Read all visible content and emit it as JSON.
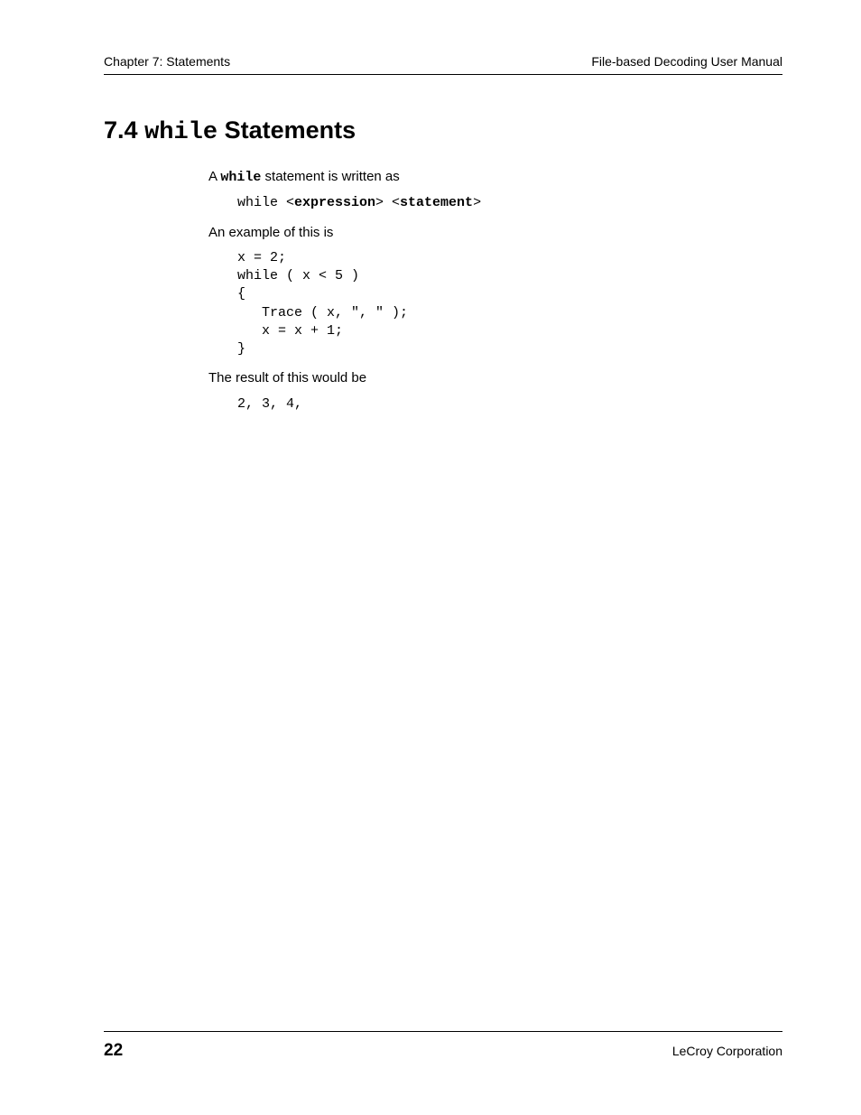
{
  "header": {
    "left": "Chapter 7: Statements",
    "right": "File-based Decoding User Manual"
  },
  "section": {
    "number": "7.4",
    "keyword": "while",
    "heading_suffix": " Statements"
  },
  "body": {
    "p1_prefix": "A ",
    "p1_code": "while",
    "p1_suffix": " statement is written as",
    "syntax_prefix": "while <",
    "syntax_expr": "expression",
    "syntax_mid": "> <",
    "syntax_stmt": "statement",
    "syntax_end": ">",
    "p2": "An example of this is",
    "code_example": "x = 2;\nwhile ( x < 5 )\n{\n   Trace ( x, \", \" );\n   x = x + 1;\n}",
    "p3": "The result of this would be",
    "result": "2, 3, 4,"
  },
  "footer": {
    "page": "22",
    "org": "LeCroy Corporation"
  }
}
